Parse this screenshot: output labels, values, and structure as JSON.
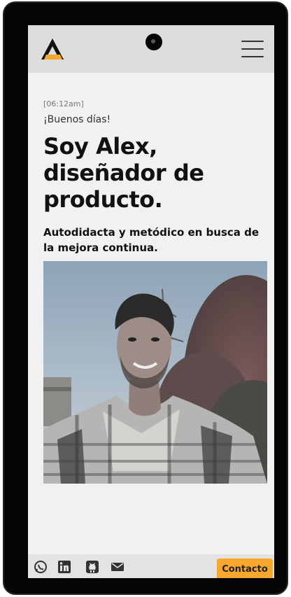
{
  "header": {
    "logo_icon": "triangle-a-logo-icon",
    "menu_icon": "hamburger-menu-icon"
  },
  "hero": {
    "time": "[06:12am]",
    "greeting": "¡Buenos días!",
    "headline": "Soy Alex, diseñador de producto.",
    "subtitle": "Autodidacta y metódico en busca de la mejora continua."
  },
  "footer": {
    "social_icons": [
      "whatsapp-icon",
      "linkedin-icon",
      "github-icon",
      "mail-icon"
    ],
    "contact_label": "Contacto"
  },
  "colors": {
    "accent": "#f9a72c",
    "text": "#111111",
    "background": "#f1f1f1",
    "bar": "#dcdcdc"
  }
}
